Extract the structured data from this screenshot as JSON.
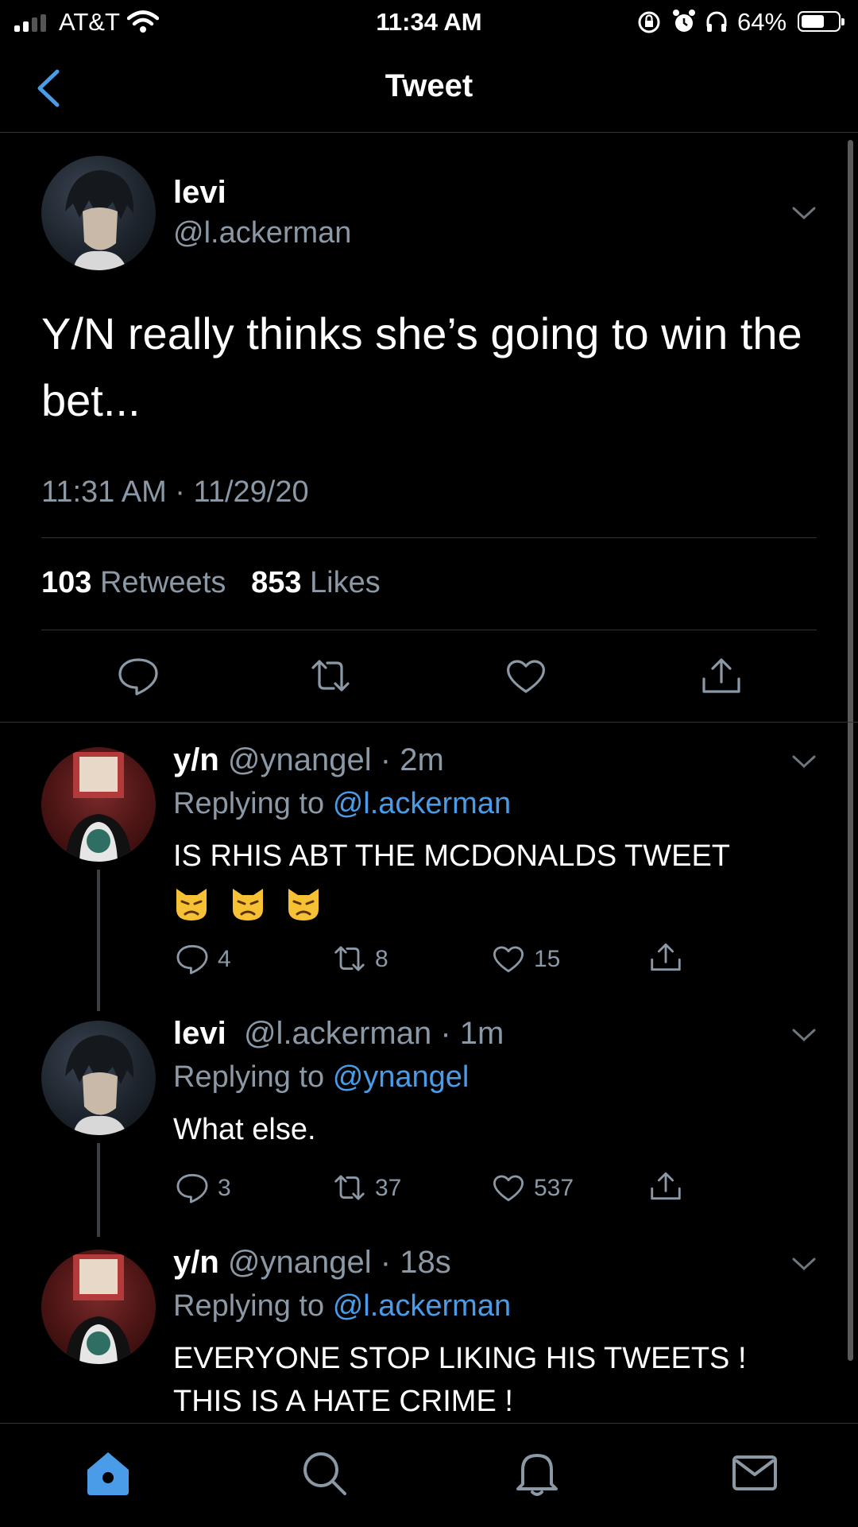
{
  "status_bar": {
    "carrier": "AT&T",
    "time": "11:34 AM",
    "battery": "64%"
  },
  "header": {
    "title": "Tweet"
  },
  "main_tweet": {
    "name": "levi",
    "handle": "@l.ackerman",
    "text": "Y/N really thinks she’s going to win the bet...",
    "timestamp": "11:31 AM · 11/29/20",
    "retweets_count": "103",
    "retweets_label": "Retweets",
    "likes_count": "853",
    "likes_label": "Likes"
  },
  "replies": [
    {
      "name": "y/n",
      "handle": "@ynangel",
      "time": "· 2m",
      "replying_label": "Replying to",
      "replying_to": "@l.ackerman",
      "text": "IS RHIS ABT THE MCDONALDS TWEET",
      "emoji": [
        "pouting-cat",
        "pouting-cat",
        "pouting-cat"
      ],
      "reply_count": "4",
      "retweet_count": "8",
      "like_count": "15"
    },
    {
      "name": "levi",
      "handle": "@l.ackerman",
      "time": "· 1m",
      "replying_label": "Replying to",
      "replying_to": "@ynangel",
      "text": "What else.",
      "reply_count": "3",
      "retweet_count": "37",
      "like_count": "537"
    },
    {
      "name": "y/n",
      "handle": "@ynangel",
      "time": "· 18s",
      "replying_label": "Replying to",
      "replying_to": "@l.ackerman",
      "text_line1": "EVERYONE STOP LIKING HIS TWEETS !",
      "text_line2": "THIS IS A HATE CRIME !"
    }
  ],
  "tabs": [
    "home-icon",
    "search-icon",
    "notifications-icon",
    "messages-icon"
  ],
  "colors": {
    "accent": "#4a9ce8",
    "muted": "#8b98a5",
    "background": "#000000"
  }
}
